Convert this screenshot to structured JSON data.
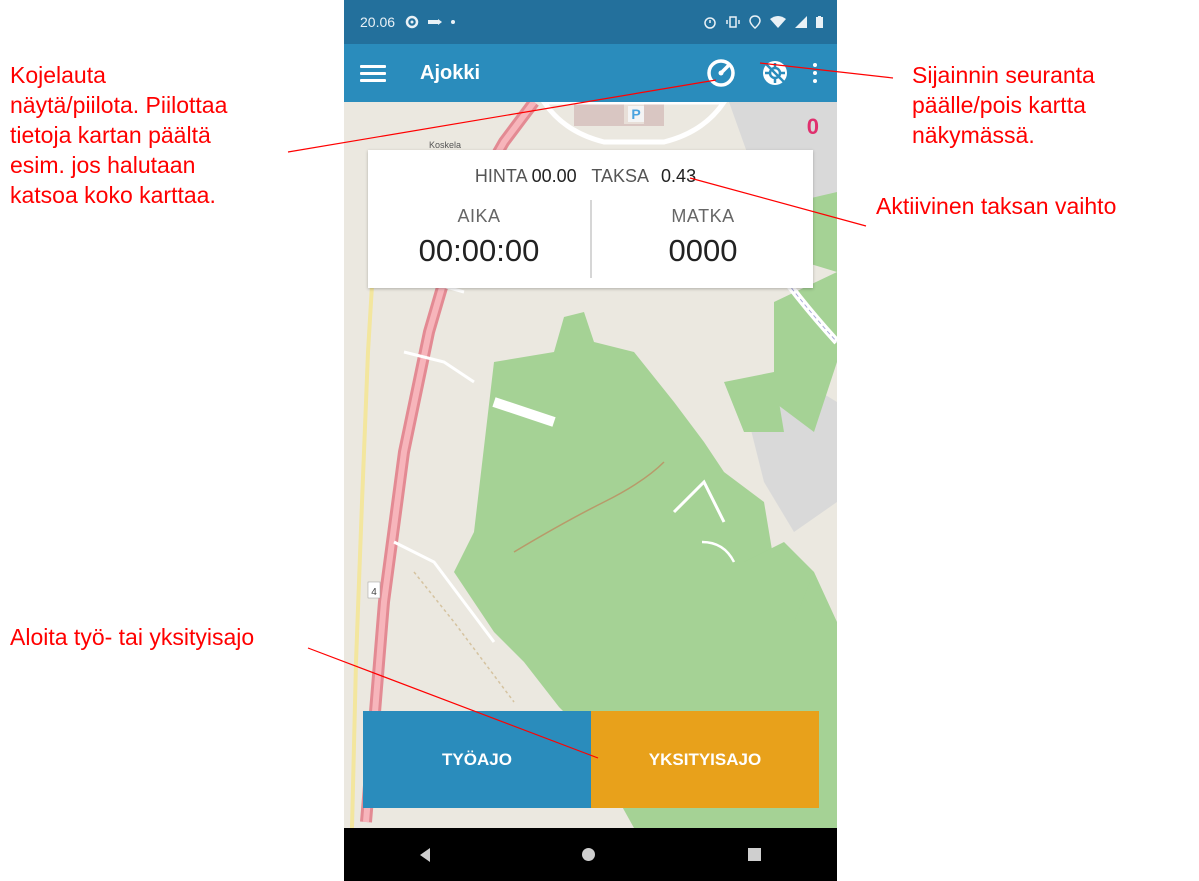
{
  "annotations": {
    "dashboard_toggle": "Kojelauta\nnäytä/piilota. Piilottaa\ntietoja kartan päältä\nesim. jos halutaan\nkatsoa koko karttaa.",
    "location_tracking": "Sijainnin seuranta\npäälle/pois kartta\nnäkymässä.",
    "active_rate": "Aktiivinen taksan vaihto",
    "start_trip": "Aloita työ- tai yksityisajo",
    "color": "#ff0000"
  },
  "status_bar": {
    "time": "20.06"
  },
  "app_bar": {
    "title": "Ajokki",
    "icons": [
      "menu-icon",
      "speedometer-icon",
      "location-tracking-icon",
      "more-vert-icon"
    ]
  },
  "map": {
    "counter": "0",
    "labels": [
      "Koskela",
      "P",
      "4"
    ]
  },
  "dashboard": {
    "price_label": "HINTA",
    "price_value": "00.00",
    "rate_label": "TAKSA",
    "rate_value": "0.43",
    "time_label": "AIKA",
    "time_value": "00:00:00",
    "distance_label": "MATKA",
    "distance_value": "0000"
  },
  "buttons": {
    "work_trip": "TYÖAJO",
    "private_trip": "YKSITYISAJO"
  },
  "colors": {
    "app_bar": "#2a8cbc",
    "status_bar": "#23709c",
    "work_button": "#2a8cbc",
    "private_button": "#e8a11b",
    "counter": "#e0306e",
    "park": "#a5d295"
  }
}
